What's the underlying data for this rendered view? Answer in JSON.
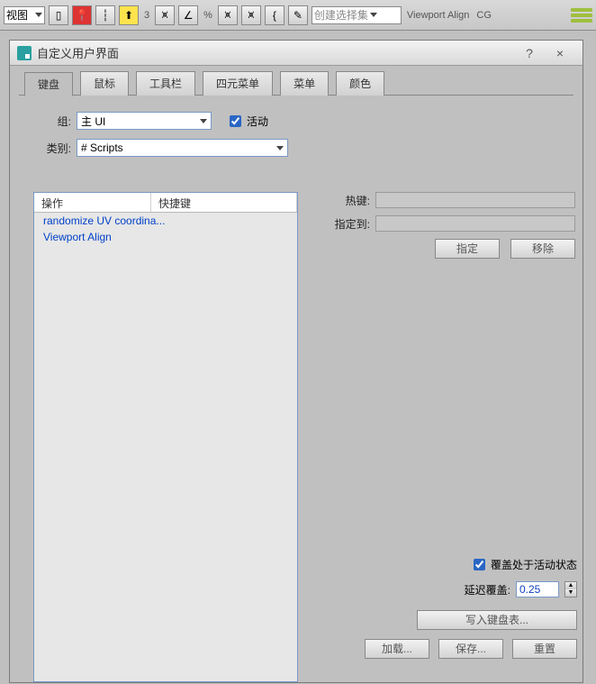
{
  "app_toolbar": {
    "view_dropdown": "视图",
    "selection_set_placeholder": "创建选择集",
    "viewport_align": "Viewport Align",
    "cg_label": "CG",
    "num3": "3",
    "pct": "%"
  },
  "dialog": {
    "title": "自定义用户界面",
    "help": "?",
    "close": "×",
    "tabs": {
      "keyboard": "键盘",
      "mouse": "鼠标",
      "toolbar": "工具栏",
      "quad": "四元菜单",
      "menu": "菜单",
      "color": "颜色"
    },
    "group_label": "组:",
    "group_value": "主 UI",
    "active_chk": "活动",
    "category_label": "类别:",
    "category_value": "# Scripts",
    "list": {
      "col_action": "操作",
      "col_shortcut": "快捷键",
      "items": [
        "randomize UV coordina...",
        "Viewport Align"
      ]
    },
    "right": {
      "hotkey_label": "热键:",
      "assigned_label": "指定到:",
      "assign_btn": "指定",
      "remove_btn": "移除"
    },
    "lower": {
      "override_active": "覆盖处于活动状态",
      "delay_label": "延迟覆盖:",
      "delay_value": "0.25",
      "write_keyboard": "写入键盘表..."
    },
    "bottom": {
      "load": "加载...",
      "save": "保存...",
      "reset": "重置"
    }
  }
}
